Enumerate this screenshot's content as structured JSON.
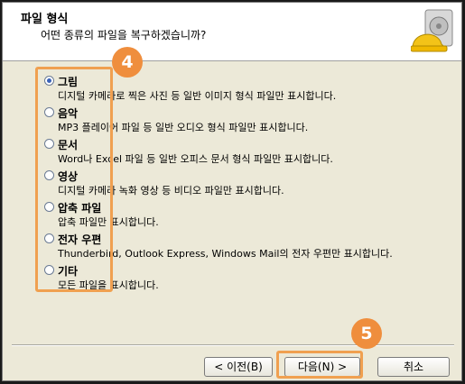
{
  "header": {
    "title": "파일 형식",
    "subtitle": "어떤 종류의 파일을 복구하겠습니까?"
  },
  "options": [
    {
      "label": "그림",
      "desc": "디지털 카메라로 찍은 사진 등 일반 이미지 형식 파일만 표시합니다.",
      "checked": true
    },
    {
      "label": "음악",
      "desc": "MP3 플레이어 파일 등 일반 오디오 형식 파일만 표시합니다.",
      "checked": false
    },
    {
      "label": "문서",
      "desc": "Word나 Excel 파일 등 일반 오피스 문서 형식 파일만 표시합니다.",
      "checked": false
    },
    {
      "label": "영상",
      "desc": "디지털 카메라 녹화 영상 등 비디오 파일만 표시합니다.",
      "checked": false
    },
    {
      "label": "압축 파일",
      "desc": "압축 파일만 표시합니다.",
      "checked": false
    },
    {
      "label": "전자 우편",
      "desc": "Thunderbird, Outlook Express, Windows Mail의 전자 우편만 표시합니다.",
      "checked": false
    },
    {
      "label": "기타",
      "desc": "모든 파일을 표시합니다.",
      "checked": false
    }
  ],
  "buttons": {
    "back": "< 이전(B)",
    "next": "다음(N) >",
    "cancel": "취소"
  },
  "annotations": {
    "badge_options": "4",
    "badge_next": "5"
  },
  "colors": {
    "highlight": "#f0a050",
    "badge": "#ef8e3d"
  }
}
